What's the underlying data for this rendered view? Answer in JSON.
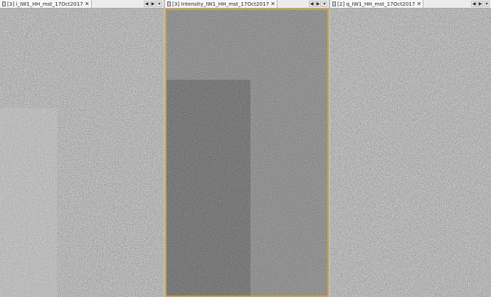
{
  "panes": [
    {
      "tab_label": "[3] i_IW1_HH_mst_17Oct2017",
      "close": "✕",
      "active": false
    },
    {
      "tab_label": "[3] Intensity_IW1_HH_mst_17Oct2017",
      "close": "✕",
      "active": true
    },
    {
      "tab_label": "[2] q_IW1_HH_mst_17Oct2017",
      "close": "✕",
      "active": false
    }
  ],
  "nav": {
    "prev": "◀",
    "next": "▶",
    "menu": "▾"
  },
  "colors": {
    "active_border": "#c9a24a",
    "tab_bg": "#f7f7f7",
    "tabbar_bg": "#ececec"
  }
}
